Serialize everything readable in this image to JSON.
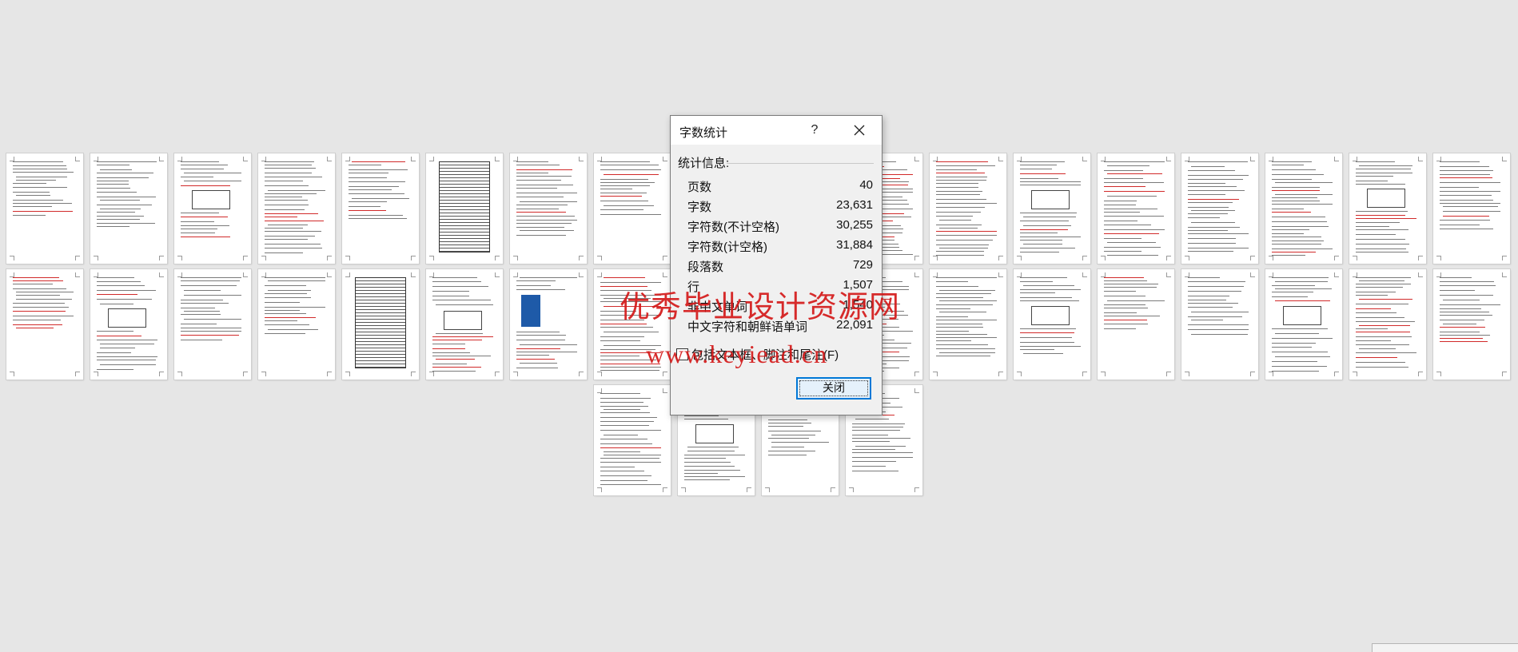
{
  "document": {
    "page_count_thumbnails": 40
  },
  "dialog": {
    "title": "字数统计",
    "help_label": "?",
    "close_icon": "close-icon",
    "section_label": "统计信息:",
    "stats": [
      {
        "label": "页数",
        "value": "40"
      },
      {
        "label": "字数",
        "value": "23,631"
      },
      {
        "label": "字符数(不计空格)",
        "value": "30,255"
      },
      {
        "label": "字符数(计空格)",
        "value": "31,884"
      },
      {
        "label": "段落数",
        "value": "729"
      },
      {
        "label": "行",
        "value": "1,507"
      },
      {
        "label": "非中文单词",
        "value": "1,540"
      },
      {
        "label": "中文字符和朝鲜语单词",
        "value": "22,091"
      }
    ],
    "checkbox_label": "包括文本框、脚注和尾注(F)",
    "checkbox_checked": false,
    "close_button_label": "关闭"
  },
  "watermark": {
    "line1": "优秀毕业设计资源网",
    "line2": "www.keyiead.cn"
  },
  "colors": {
    "background": "#e6e6e6",
    "dialog_bg": "#f0f0f0",
    "accent": "#0078d7",
    "watermark": "#d41a1a"
  }
}
